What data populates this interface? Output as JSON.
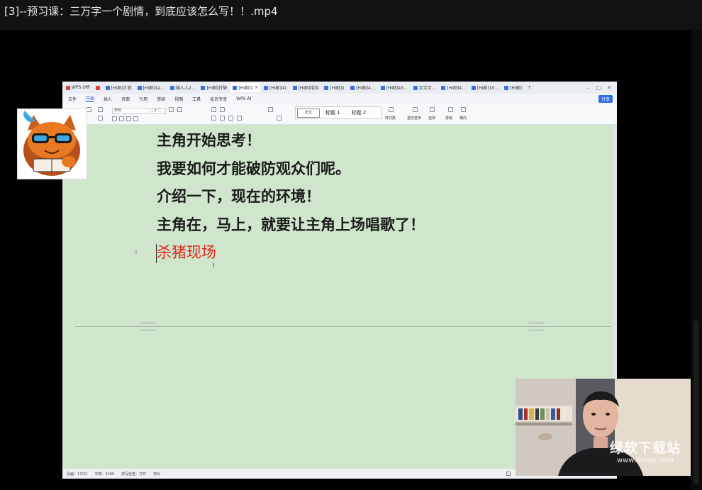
{
  "player": {
    "title": "[3]--预习课：三万字一个剧情，到底应该怎么写！！.mp4"
  },
  "wps": {
    "tabs": [
      {
        "label": "WPS Offi",
        "icon": "wps-logo-icon"
      },
      {
        "label": "",
        "icon": "red-doc-icon"
      },
      {
        "label": "[Hi剧]计划"
      },
      {
        "label": "[Hi剧]42..."
      },
      {
        "label": "插入人2..."
      },
      {
        "label": "[Hi剧]打破"
      },
      {
        "label": "[Hi剧]1",
        "active": true
      },
      {
        "label": "[Hi剧]41"
      },
      {
        "label": "[Hi剧]增加"
      },
      {
        "label": "[Hi剧]1"
      },
      {
        "label": "[Hi剧]4..."
      },
      {
        "label": "[Hi剧]43..."
      },
      {
        "label": "文字文..."
      },
      {
        "label": "[Hi剧]4..."
      },
      {
        "label": "[Hi剧]10..."
      },
      {
        "label": "[Hi剧]"
      }
    ],
    "menu": [
      "文件",
      "开始",
      "插入",
      "页面",
      "引用",
      "审阅",
      "视图",
      "工具",
      "会员专享",
      "WPS AI"
    ],
    "active_menu": "开始",
    "share_label": "分享",
    "ribbon": {
      "font_name": "宋体",
      "font_size": "小二",
      "styles": [
        "正文",
        "标题 1",
        "标题 2"
      ],
      "labels": {
        "styles": "样式集",
        "find": "查找替换",
        "select": "选择",
        "layout": "排版",
        "columns": "横向"
      }
    },
    "document": {
      "lines": [
        "主角开始思考！",
        "我要如何才能破防观众们呢。",
        "介绍一下，现在的环境！",
        "主角在，马上，就要让主角上场唱歌了！"
      ],
      "red_line": "杀猪现场"
    },
    "status": {
      "page": "页面：17/22",
      "words": "字数：3299",
      "spell": "拼写检查：打开",
      "proof": "校对"
    },
    "colors": {
      "page_bg": "#cfe5cc",
      "red_text": "#e0281c",
      "accent": "#2a5bd7"
    }
  },
  "watermark": {
    "name": "绿软下载站",
    "url": "www.itmop.com"
  }
}
